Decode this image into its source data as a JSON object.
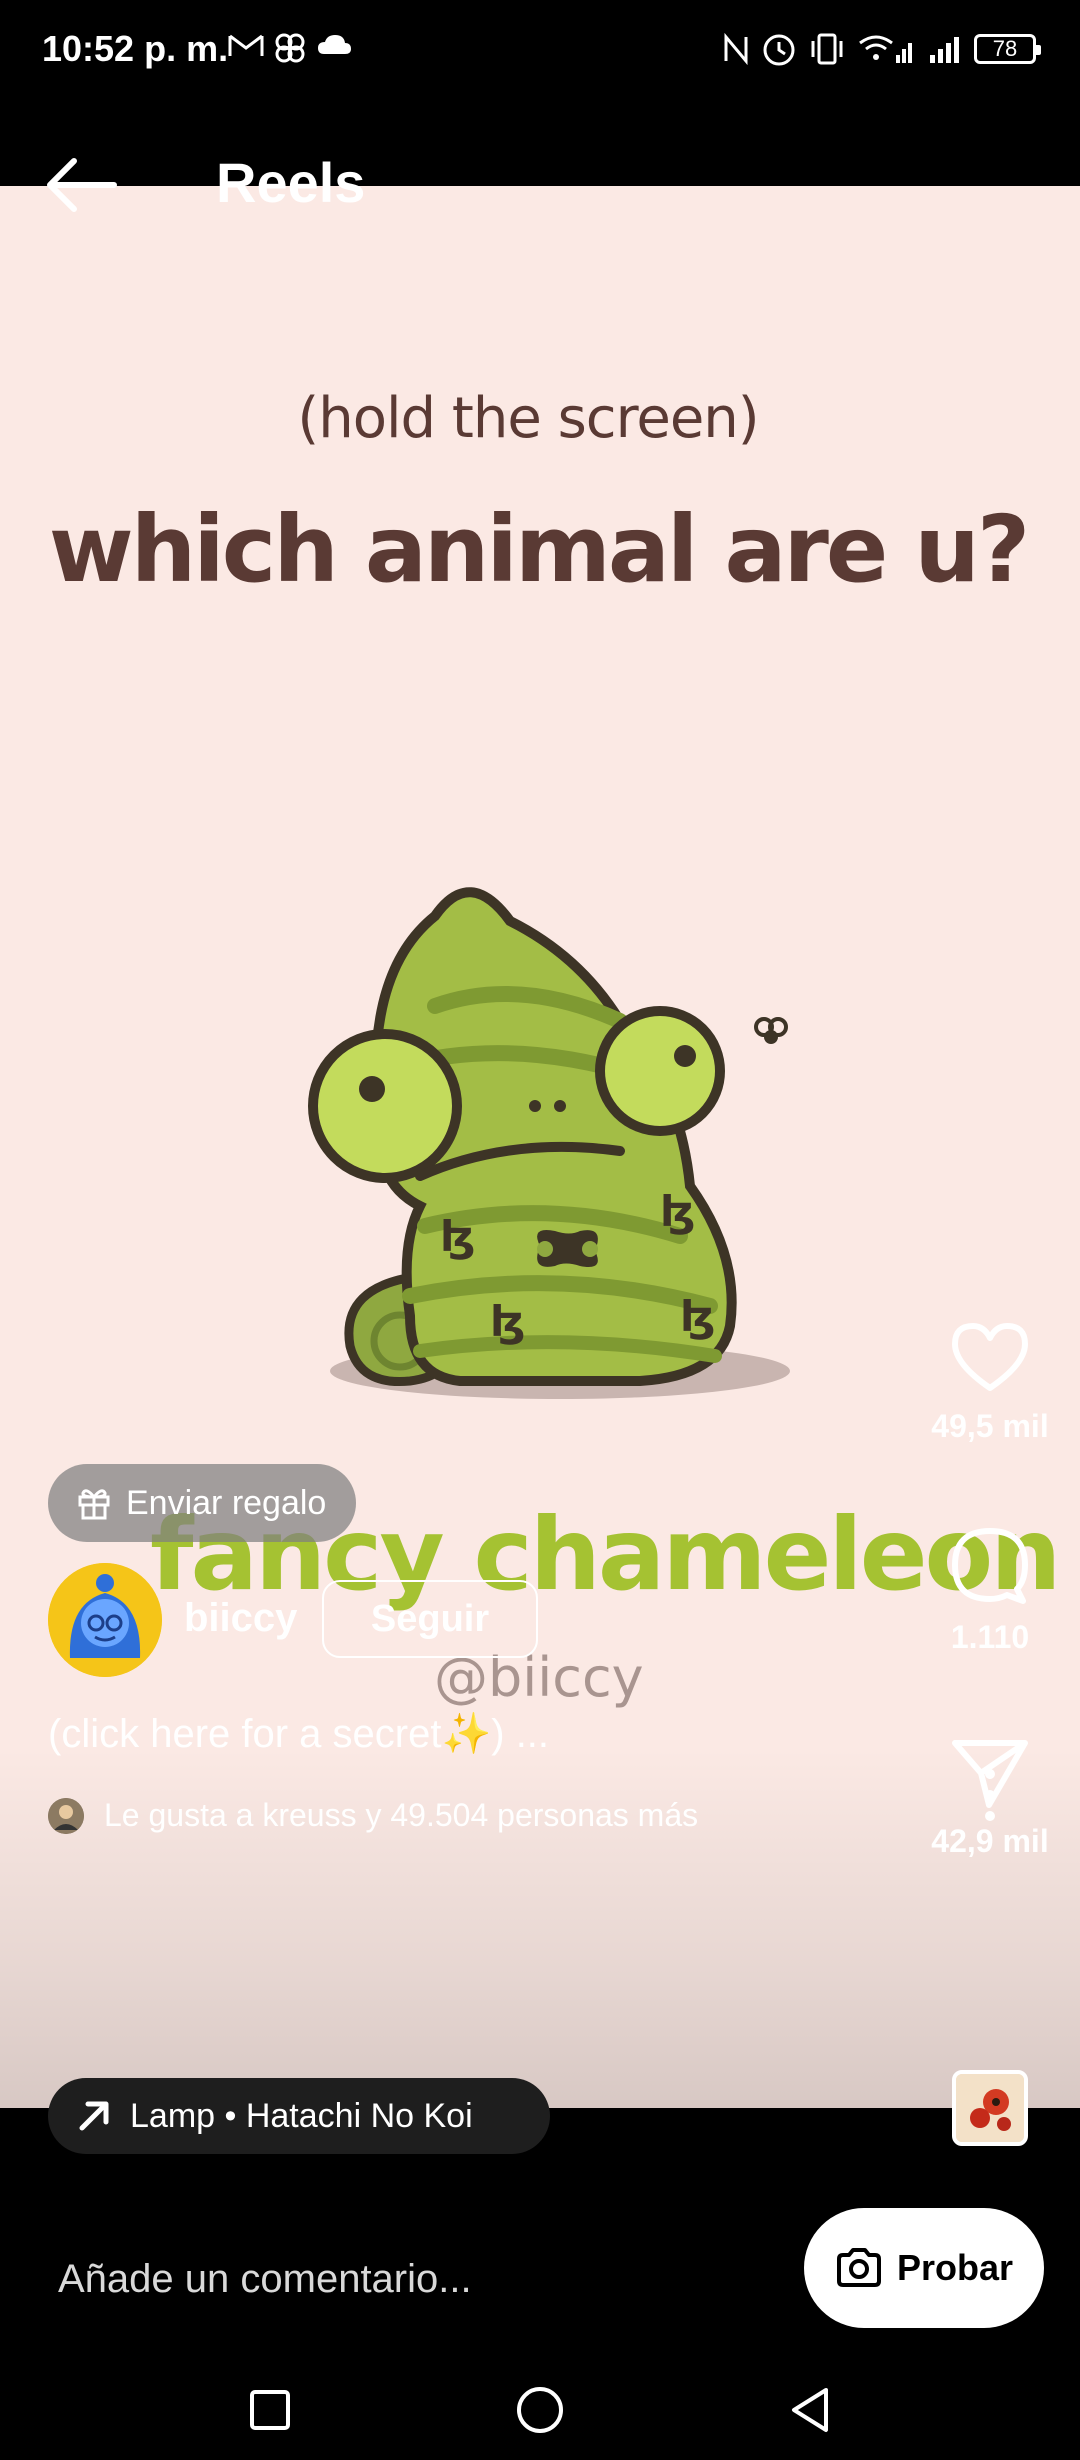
{
  "status_bar": {
    "time": "10:52 p. m.",
    "battery": "78",
    "left_icons": [
      "gmail-icon",
      "pinwheel-icon",
      "cloud-icon"
    ],
    "right_icons": [
      "nfc-icon",
      "alarm-icon",
      "vibrate-icon",
      "wifi-icon",
      "signal-icon",
      "signal-icon",
      "battery-icon"
    ]
  },
  "header": {
    "title": "Reels"
  },
  "reel": {
    "hold_text": "(hold the screen)",
    "question": "which animal are u?",
    "result": "fancy chameleon",
    "watermark_handle": "@biiccy",
    "background_color": "#fbe9e4"
  },
  "actions": {
    "likes": "49,5 mil",
    "comments": "1.110",
    "shares": "42,9 mil"
  },
  "gift": {
    "label": "Enviar regalo"
  },
  "profile": {
    "username": "biiccy",
    "follow_label": "Seguir"
  },
  "caption": "(click here for a secret✨) ...",
  "liked_by": "Le gusta a kreuss y 49.504 personas más",
  "music": {
    "label": "Lamp • Hatachi No Koi"
  },
  "comment": {
    "placeholder": "Añade un comentario..."
  },
  "try_button": {
    "label": "Probar"
  },
  "colors": {
    "accent_green": "#a5c232",
    "text_brown": "#5a3a34"
  }
}
